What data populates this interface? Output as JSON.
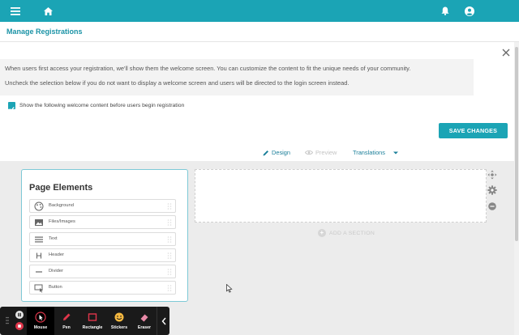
{
  "header": {
    "menu_icon": "hamburger-menu-icon",
    "home_icon": "home-icon",
    "bell_icon": "bell-icon",
    "account_icon": "user-account-icon"
  },
  "subheader": {
    "title": "Manage Registrations"
  },
  "welcome": {
    "line1": "When users first access your registration, we'll show them the welcome screen. You can customize the content to fit the unique needs of your community.",
    "line2": "Uncheck the selection below if you do not want to display a welcome screen and users will be directed to the login screen instead.",
    "checkbox_label": "Show the following welcome content before users begin registration",
    "checkbox_checked": true
  },
  "actions": {
    "save_label": "SAVE CHANGES"
  },
  "tabs": {
    "design": "Design",
    "preview": "Preview",
    "translations": "Translations"
  },
  "page_elements": {
    "title": "Page Elements",
    "items": [
      {
        "label": "Background",
        "icon": "palette-icon"
      },
      {
        "label": "Files/Images",
        "icon": "image-icon"
      },
      {
        "label": "Text",
        "icon": "text-lines-icon"
      },
      {
        "label": "Header",
        "icon": "header-h-icon"
      },
      {
        "label": "Divider",
        "icon": "divider-icon"
      },
      {
        "label": "Button",
        "icon": "button-click-icon"
      }
    ]
  },
  "canvas": {
    "add_section_label": "ADD A SECTION"
  },
  "annotation_toolbar": {
    "tools": [
      {
        "label": "Mouse",
        "icon": "mouse-cursor-icon"
      },
      {
        "label": "Pen",
        "icon": "pen-icon"
      },
      {
        "label": "Rectangle",
        "icon": "rectangle-icon"
      },
      {
        "label": "Stickers",
        "icon": "sticker-smiley-icon"
      },
      {
        "label": "Eraser",
        "icon": "eraser-icon"
      }
    ]
  },
  "colors": {
    "brand": "#1ba4b5",
    "link": "#1b7f9a",
    "toolbar_bg": "#1a1a1a",
    "tool_accent": "#e0364b"
  }
}
